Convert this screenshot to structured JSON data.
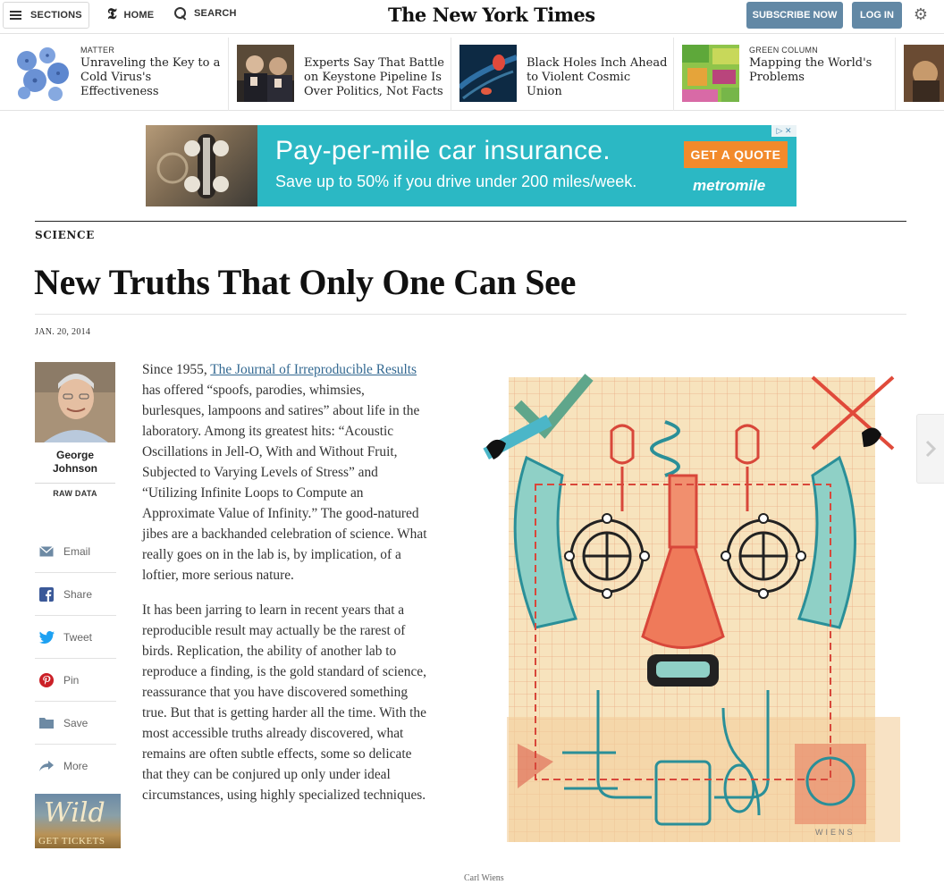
{
  "masthead": {
    "sections_label": "SECTIONS",
    "home_label": "HOME",
    "search_label": "SEARCH",
    "logo_text": "The New York Times",
    "subscribe_label": "SUBSCRIBE NOW",
    "login_label": "LOG IN",
    "t_logo": "𝕿"
  },
  "ribbon": [
    {
      "kicker": "MATTER",
      "title": "Unraveling the Key to a Cold Virus's Effectiveness"
    },
    {
      "kicker": "",
      "title": "Experts Say That Battle on Keystone Pipeline Is Over Politics, Not Facts"
    },
    {
      "kicker": "",
      "title": "Black Holes Inch Ahead to Violent Cosmic Union"
    },
    {
      "kicker": "GREEN COLUMN",
      "title": "Mapping the World's Problems"
    }
  ],
  "ad": {
    "headline": "Pay-per-mile car insurance.",
    "subline": "Save up to 50% if you drive under 200 miles/week.",
    "cta": "GET A QUOTE",
    "brand": "metromile",
    "choices": "▷ ✕"
  },
  "article": {
    "kicker": "SCIENCE",
    "headline": "New Truths That Only One Can See",
    "date": "JAN. 20, 2014",
    "author_name": "George Johnson",
    "author_column": "RAW DATA",
    "p1_before": "Since 1955, ",
    "p1_link": "The Journal of Irreproducible Results",
    "p1_after": " has offered “spoofs, parodies, whimsies, burlesques, lampoons and satires” about life in the laboratory. Among its greatest hits: “Acoustic Oscillations in Jell-O, With and Without Fruit, Subjected to Varying Levels of Stress” and “Utilizing Infinite Loops to Compute an Approximate Value of Infinity.” The good-natured jibes are a backhanded celebration of science. What really goes on in the lab is, by implication, of a loftier, more serious nature.",
    "p2": "It has been jarring to learn in recent years that a reproducible result may actually be the rarest of birds. Replication, the ability of another lab to reproduce a finding, is the gold standard of science, reassurance that you have discovered something true. But that is getting harder all the time. With the most accessible truths already discovered, what remains are often subtle effects, some so delicate that they can be conjured up only under ideal circumstances, using highly specialized techniques.",
    "caption": "Carl Wiens",
    "illus_signature": "WIENS"
  },
  "share": [
    {
      "label": "Email",
      "icon": "email-icon"
    },
    {
      "label": "Share",
      "icon": "facebook-icon"
    },
    {
      "label": "Tweet",
      "icon": "twitter-icon"
    },
    {
      "label": "Pin",
      "icon": "pinterest-icon"
    },
    {
      "label": "Save",
      "icon": "folder-icon"
    },
    {
      "label": "More",
      "icon": "arrow-icon"
    }
  ],
  "sidebar_ad": {
    "title": "Wild",
    "cta": "GET TICKETS"
  },
  "colors": {
    "button_blue": "#6288a5",
    "link_blue": "#326891",
    "ad_teal": "#2bb8c4",
    "ad_orange": "#f28a2b"
  }
}
